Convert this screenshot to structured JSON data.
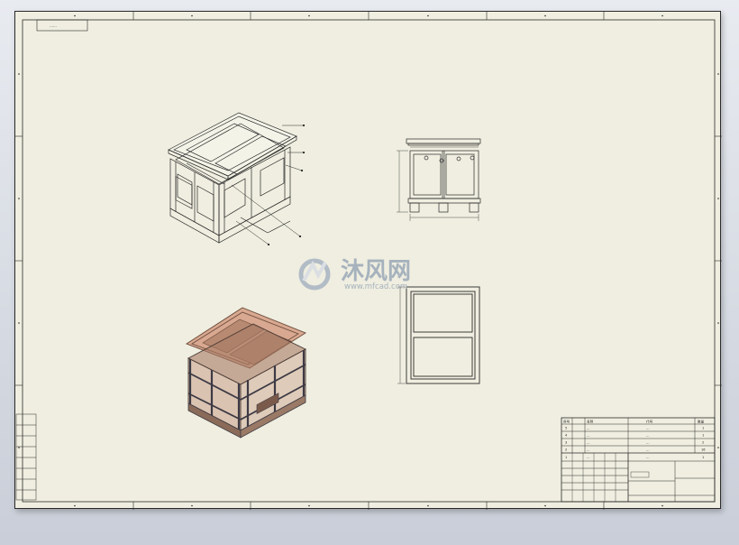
{
  "sheet": {
    "title_box_text": "……",
    "zone_numbers_top": [
      "1",
      "2",
      "3",
      "4",
      "5",
      "6"
    ],
    "zone_letters_side": [
      "A",
      "B",
      "C",
      "D"
    ]
  },
  "watermark": {
    "brand": "沐风网",
    "url": "www.mfcad.com"
  },
  "bom": {
    "headers": [
      "序号",
      "名称",
      "代号",
      "数量"
    ],
    "rows": [
      {
        "no": "5",
        "name": "…",
        "code": "…",
        "qty": "1"
      },
      {
        "no": "4",
        "name": "…",
        "code": "…",
        "qty": "1"
      },
      {
        "no": "3",
        "name": "…",
        "code": "…",
        "qty": "2"
      },
      {
        "no": "2",
        "name": "…",
        "code": "…",
        "qty": "16"
      },
      {
        "no": "1",
        "name": "…",
        "code": "…",
        "qty": "1"
      }
    ]
  },
  "colors": {
    "sheet": "#efeee0",
    "line": "#2a2a2a",
    "shaded_frame": "#7a5a4a",
    "shaded_fill": "#c89a82",
    "watermark": "#9aa8b8"
  }
}
